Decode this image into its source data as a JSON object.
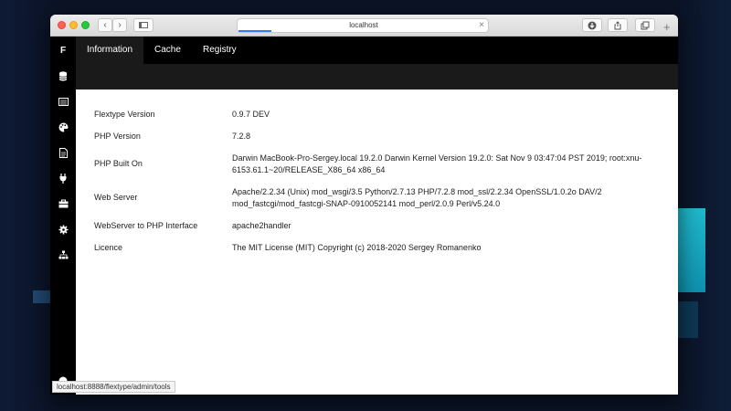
{
  "browser": {
    "address": "localhost",
    "status_url": "localhost:8888/flextype/admin/tools"
  },
  "app": {
    "brand": "F",
    "tabs": [
      {
        "label": "Information",
        "active": true
      },
      {
        "label": "Cache",
        "active": false
      },
      {
        "label": "Registry",
        "active": false
      }
    ],
    "sidebar_icons": [
      "database-icon",
      "list-icon",
      "palette-icon",
      "file-icon",
      "plug-icon",
      "toolbox-icon",
      "gear-icon",
      "sitemap-icon"
    ]
  },
  "info": {
    "rows": [
      {
        "label": "Flextype Version",
        "value": "0.9.7 DEV"
      },
      {
        "label": "PHP Version",
        "value": "7.2.8"
      },
      {
        "label": "PHP Built On",
        "value": "Darwin MacBook-Pro-Sergey.local 19.2.0 Darwin Kernel Version 19.2.0: Sat Nov 9 03:47:04 PST 2019; root:xnu-6153.61.1~20/RELEASE_X86_64 x86_64"
      },
      {
        "label": "Web Server",
        "value": "Apache/2.2.34 (Unix) mod_wsgi/3.5 Python/2.7.13 PHP/7.2.8 mod_ssl/2.2.34 OpenSSL/1.0.2o DAV/2 mod_fastcgi/mod_fastcgi-SNAP-0910052141 mod_perl/2.0.9 Perl/v5.24.0"
      },
      {
        "label": "WebServer to PHP Interface",
        "value": "apache2handler"
      },
      {
        "label": "Licence",
        "value": "The MIT License (MIT) Copyright (c) 2018-2020 Sergey Romanenko"
      }
    ]
  },
  "colors": {
    "sidebar_bg": "#000000",
    "subbar_bg": "#1a1a1a",
    "accent": "#2f7cf6"
  }
}
